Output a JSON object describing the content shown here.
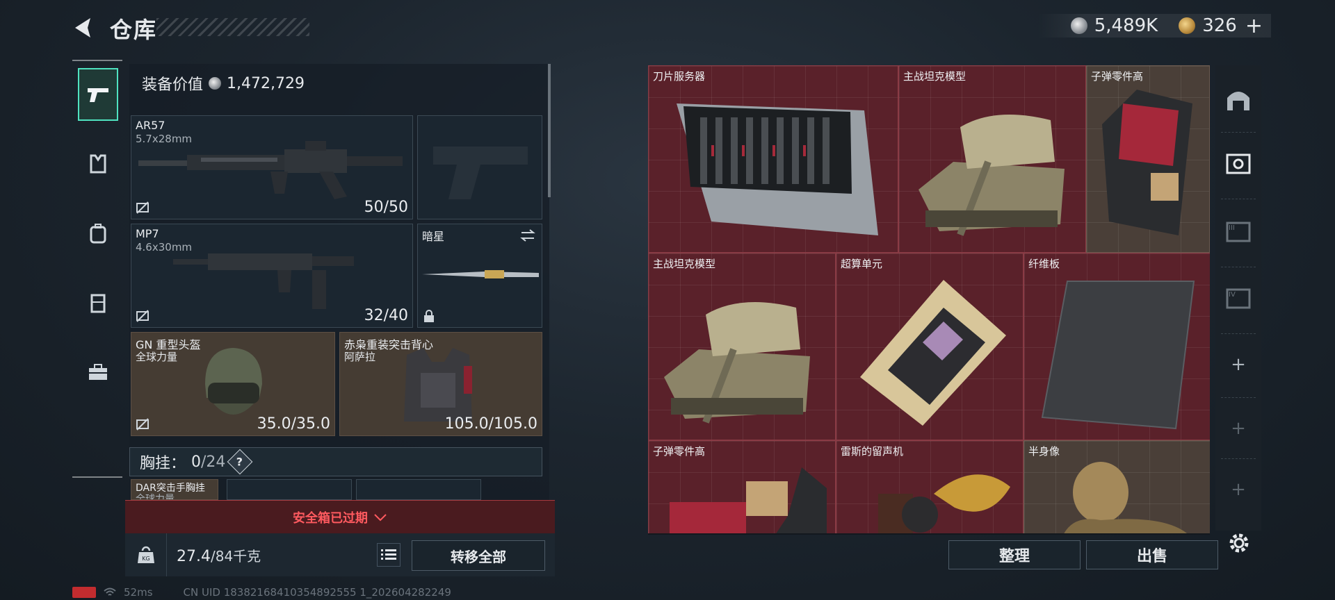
{
  "header": {
    "title": "仓库",
    "currency": {
      "silver": "5,489K",
      "gold": "326",
      "add_label": "+"
    }
  },
  "sidebar": {
    "tabs": [
      {
        "name": "weapons",
        "icon": "pistol-icon",
        "active": true
      },
      {
        "name": "armor",
        "icon": "vest-icon"
      },
      {
        "name": "backpack",
        "icon": "backpack-icon"
      },
      {
        "name": "container",
        "icon": "locker-icon"
      },
      {
        "name": "tools",
        "icon": "briefcase-icon"
      }
    ]
  },
  "loadout": {
    "equip_value_label": "装备价值",
    "equip_value": "1,472,729",
    "primary": {
      "name": "AR57",
      "ammo": "5.7x28mm",
      "count": "50/50"
    },
    "secondary": {
      "name": "MP7",
      "ammo": "4.6x30mm",
      "count": "32/40"
    },
    "melee": {
      "name": "暗星"
    },
    "helmet": {
      "name": "GN 重型头盔",
      "sub": "全球力量",
      "durability": "35.0/35.0"
    },
    "armor": {
      "name": "赤枭重装突击背心",
      "sub": "阿萨拉",
      "durability": "105.0/105.0"
    },
    "chest_rig": {
      "label": "胸挂：",
      "used": "0",
      "capacity": "/24",
      "help": "?"
    },
    "rig_item": {
      "name": "DAR突击手胸挂",
      "sub": "全球力量"
    }
  },
  "safebox": {
    "label": "安全箱已过期"
  },
  "weight": {
    "current": "27.4",
    "max": "/84千克",
    "icon_text": "KG",
    "transfer_all": "转移全部"
  },
  "status": {
    "ping": "52ms",
    "uid": "CN UID 18382168410354892555 1_202604282249"
  },
  "storage": {
    "items": [
      {
        "label": "刀片服务器",
        "icon": "blade-server"
      },
      {
        "label": "主战坦克模型",
        "icon": "tank-model"
      },
      {
        "label": "子弹零件高",
        "icon": "ammo-parts"
      },
      {
        "label": "主战坦克模型",
        "icon": "tank-model"
      },
      {
        "label": "超算单元",
        "icon": "supercompute-unit"
      },
      {
        "label": "纤维板",
        "icon": "fiber-board"
      },
      {
        "label": "子弹零件高",
        "icon": "ammo-parts"
      },
      {
        "label": "雷斯的留声机",
        "icon": "gramophone"
      },
      {
        "label": "半身像",
        "icon": "bust"
      }
    ],
    "sort_label": "整理",
    "sell_label": "出售"
  },
  "store_tabs": {
    "add_label": "+"
  },
  "colors": {
    "accent": "#4fe3c0",
    "item_bg": "#5a212a",
    "alert": "#ff5a5f"
  }
}
